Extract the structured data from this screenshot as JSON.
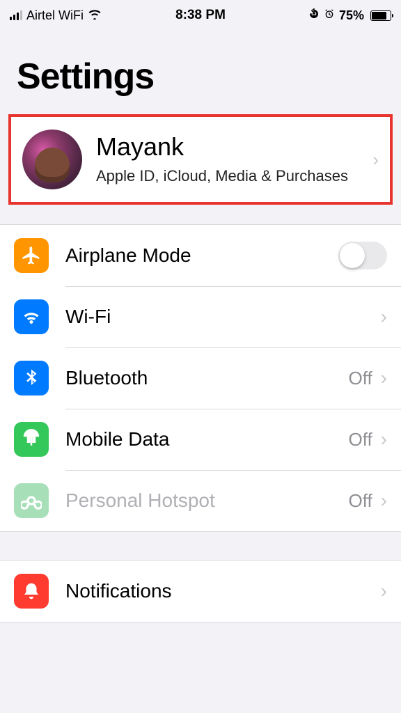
{
  "statusbar": {
    "carrier": "Airtel WiFi",
    "time": "8:38 PM",
    "battery_pct": "75%"
  },
  "page": {
    "title": "Settings"
  },
  "profile": {
    "name": "Mayank",
    "subtitle": "Apple ID, iCloud, Media & Purchases"
  },
  "rows": {
    "airplane": {
      "label": "Airplane Mode",
      "toggle": false
    },
    "wifi": {
      "label": "Wi-Fi",
      "value": ""
    },
    "bluetooth": {
      "label": "Bluetooth",
      "value": "Off"
    },
    "mobiledata": {
      "label": "Mobile Data",
      "value": "Off"
    },
    "hotspot": {
      "label": "Personal Hotspot",
      "value": "Off"
    },
    "notifications": {
      "label": "Notifications"
    }
  }
}
